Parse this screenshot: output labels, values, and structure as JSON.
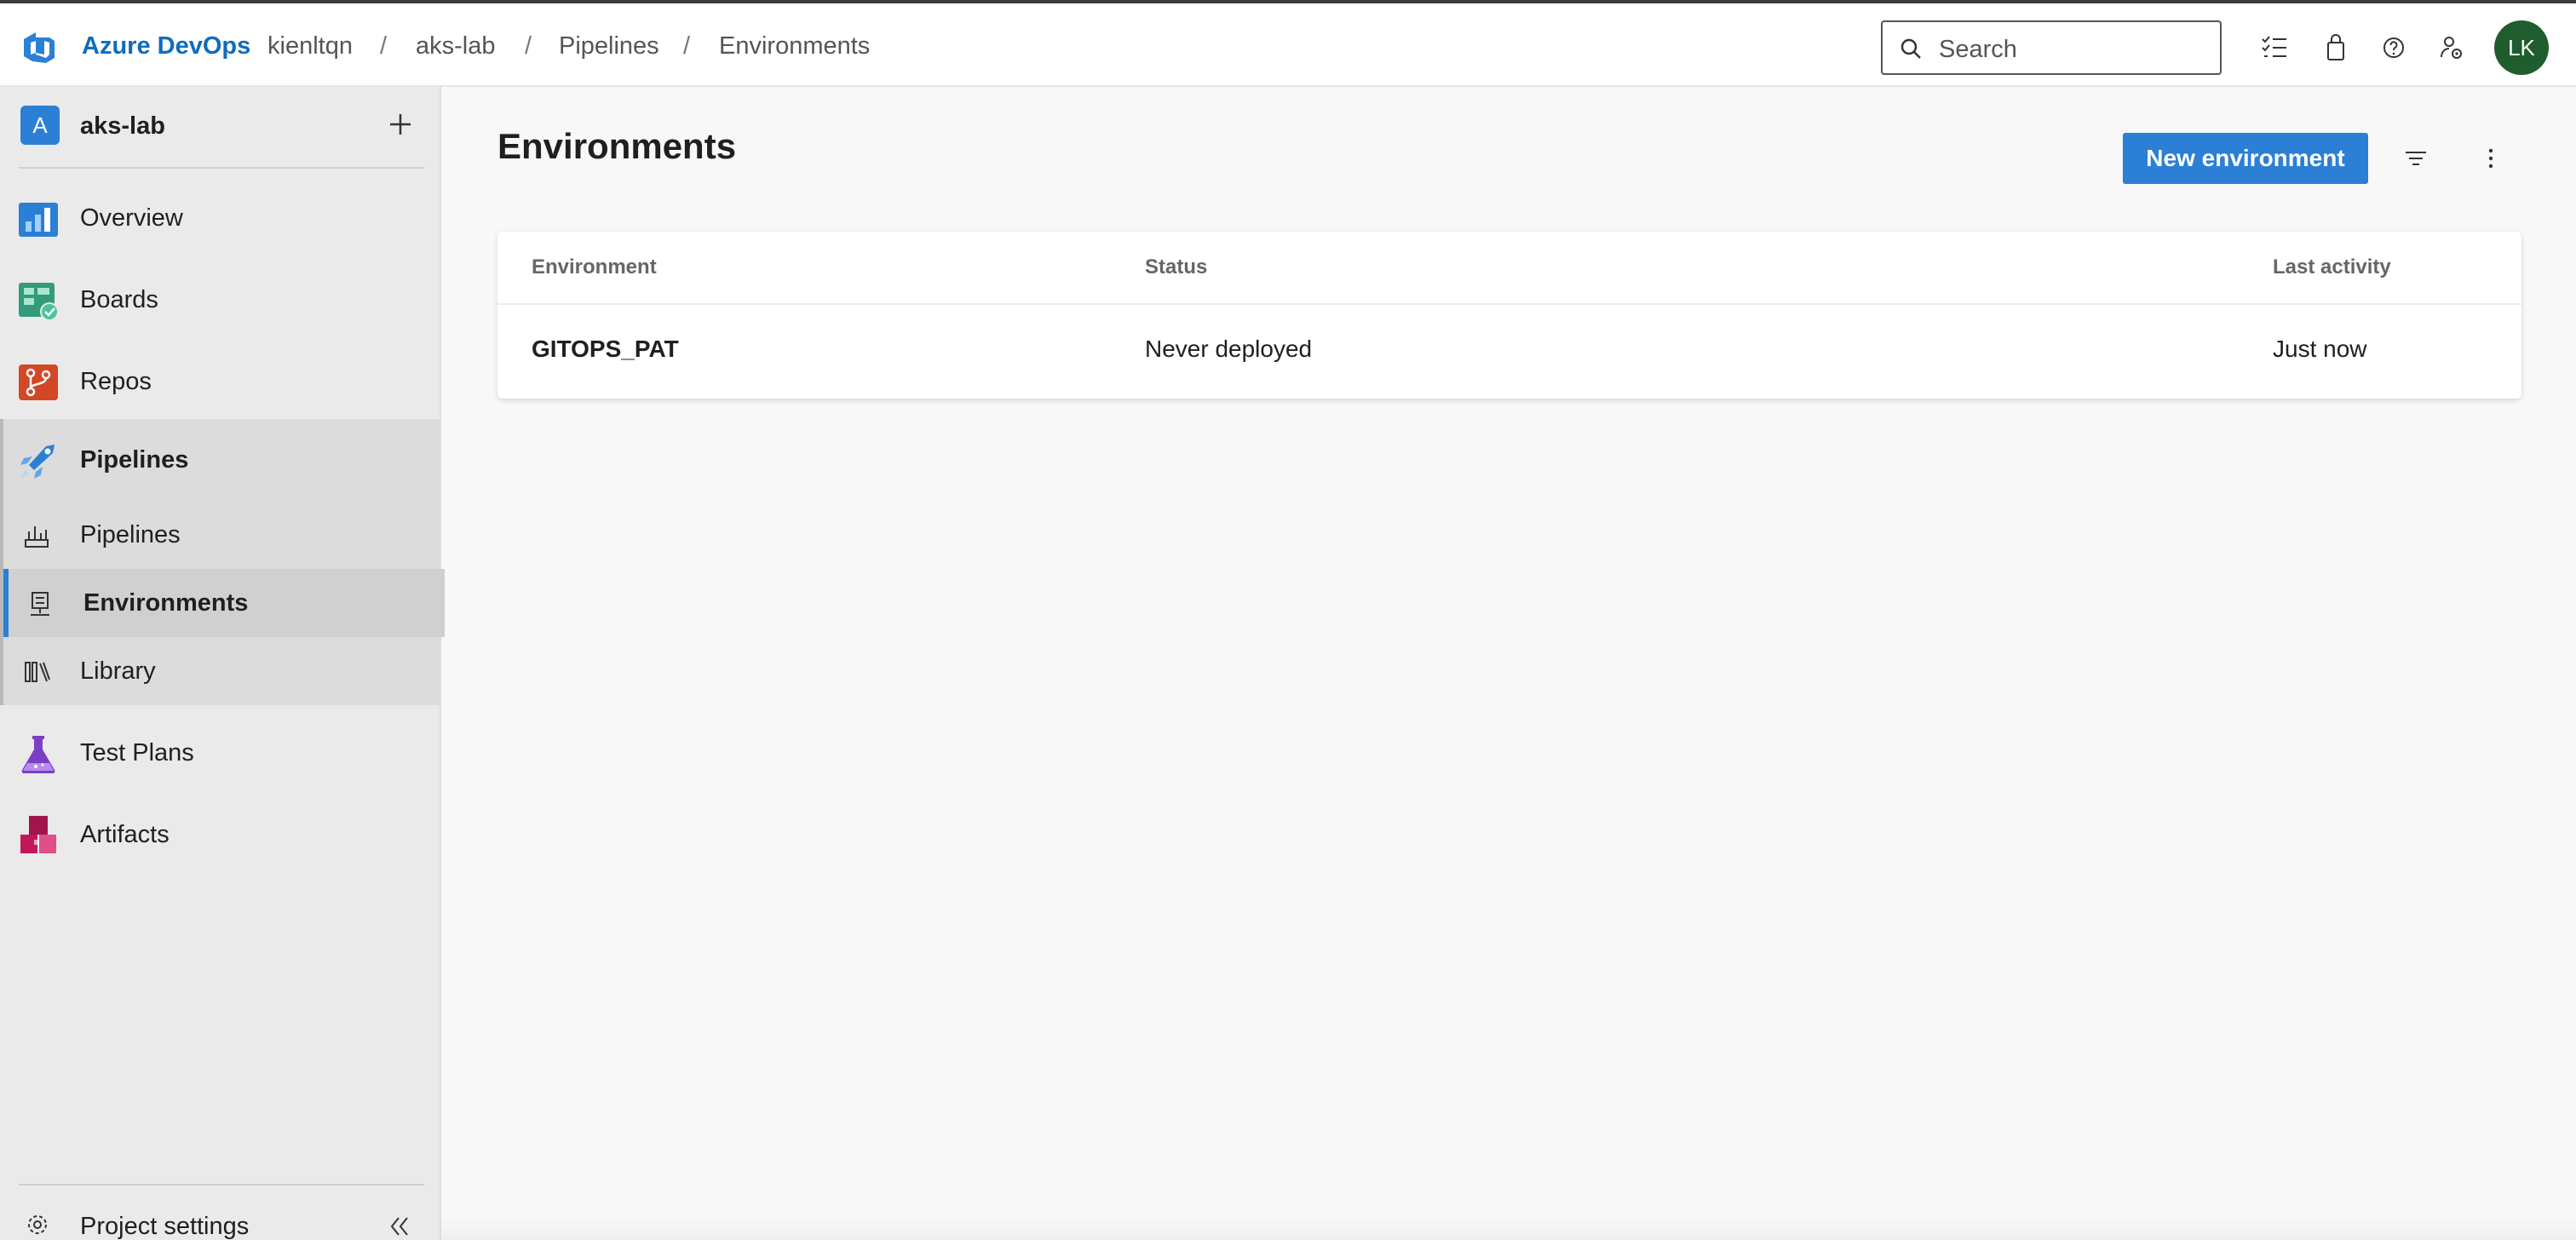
{
  "header": {
    "brand": "Azure DevOps",
    "breadcrumbs": [
      "kienltqn",
      "aks-lab",
      "Pipelines",
      "Environments"
    ],
    "separator": "/",
    "search_placeholder": "Search",
    "avatar_initials": "LK",
    "icons": [
      "task-list-icon",
      "shopping-bag-icon",
      "help-icon",
      "user-settings-icon"
    ]
  },
  "sidebar": {
    "project_initial": "A",
    "project_name": "aks-lab",
    "items": [
      {
        "label": "Overview",
        "icon": "overview-icon"
      },
      {
        "label": "Boards",
        "icon": "boards-icon"
      },
      {
        "label": "Repos",
        "icon": "repos-icon"
      },
      {
        "label": "Pipelines",
        "icon": "pipelines-icon"
      }
    ],
    "sub_items": [
      {
        "label": "Pipelines",
        "icon": "pipelines-sub-icon"
      },
      {
        "label": "Environments",
        "icon": "environments-icon",
        "active": true
      },
      {
        "label": "Library",
        "icon": "library-icon"
      }
    ],
    "bottom_items": [
      {
        "label": "Test Plans",
        "icon": "test-plans-icon"
      },
      {
        "label": "Artifacts",
        "icon": "artifacts-icon"
      }
    ],
    "settings_label": "Project settings"
  },
  "main": {
    "title": "Environments",
    "new_button": "New environment",
    "table": {
      "columns": [
        "Environment",
        "Status",
        "Last activity"
      ],
      "rows": [
        {
          "environment": "GITOPS_PAT",
          "status": "Never deployed",
          "last_activity": "Just now"
        }
      ]
    }
  },
  "colors": {
    "accent": "#2b7fd5",
    "brand": "#0f6cbd",
    "avatar": "#1f5c2e"
  }
}
